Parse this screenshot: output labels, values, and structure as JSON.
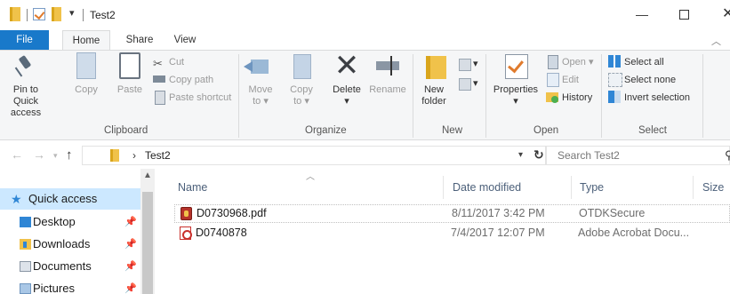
{
  "window": {
    "title": "Test2"
  },
  "tabs": {
    "file": "File",
    "home": "Home",
    "share": "Share",
    "view": "View"
  },
  "ribbon": {
    "clipboard": {
      "label": "Clipboard",
      "pin": "Pin to Quick access",
      "copy": "Copy",
      "paste": "Paste",
      "cut": "Cut",
      "copy_path": "Copy path",
      "paste_shortcut": "Paste shortcut"
    },
    "organize": {
      "label": "Organize",
      "move_to": "Move",
      "move_to_sub": "to",
      "copy_to": "Copy",
      "copy_to_sub": "to",
      "delete": "Delete",
      "rename": "Rename"
    },
    "new": {
      "label": "New",
      "new_folder": "New",
      "new_folder_sub": "folder"
    },
    "open": {
      "label": "Open",
      "properties": "Properties",
      "open": "Open",
      "edit": "Edit",
      "history": "History"
    },
    "select": {
      "label": "Select",
      "select_all": "Select all",
      "select_none": "Select none",
      "invert": "Invert selection"
    }
  },
  "address": {
    "path": "Test2",
    "search_placeholder": "Search Test2"
  },
  "navpane": {
    "items": [
      {
        "label": "Quick access",
        "icon": "star-icon"
      },
      {
        "label": "Desktop",
        "icon": "desktop-folder-icon"
      },
      {
        "label": "Downloads",
        "icon": "downloads-folder-icon"
      },
      {
        "label": "Documents",
        "icon": "documents-folder-icon"
      },
      {
        "label": "Pictures",
        "icon": "pictures-folder-icon"
      }
    ]
  },
  "filelist": {
    "columns": {
      "name": "Name",
      "date": "Date modified",
      "type": "Type",
      "size": "Size"
    },
    "rows": [
      {
        "name": "D0730968.pdf",
        "date": "8/11/2017 3:42 PM",
        "type": "OTDKSecure",
        "icon": "secure-file-icon"
      },
      {
        "name": "D0740878",
        "date": "7/4/2017 12:07 PM",
        "type": "Adobe Acrobat Docu...",
        "icon": "pdf-file-icon"
      }
    ]
  }
}
